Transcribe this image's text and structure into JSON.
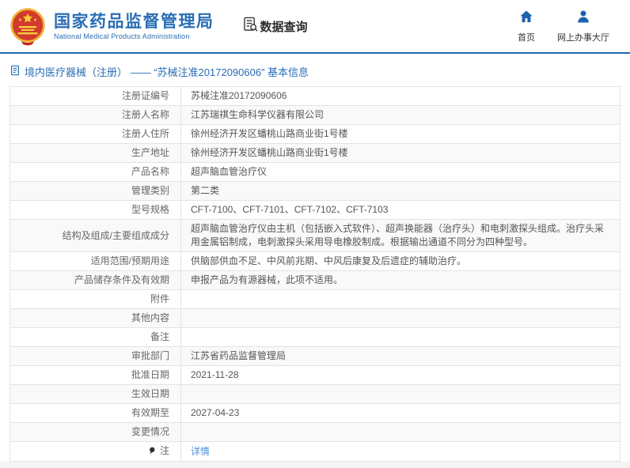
{
  "header": {
    "brand_title": "国家药品监督管理局",
    "brand_subtitle": "National Medical Products Administration",
    "data_query_label": "数据查询",
    "nav": [
      {
        "label": "首页",
        "icon": "home-icon"
      },
      {
        "label": "网上办事大厅",
        "icon": "user-icon"
      }
    ]
  },
  "breadcrumb": {
    "text": "境内医疗器械（注册） —— “苏械注准20172090606” 基本信息"
  },
  "table": {
    "rows": [
      {
        "label": "注册证编号",
        "value": "苏械注准20172090606"
      },
      {
        "label": "注册人名称",
        "value": "江苏瑞祺生命科学仪器有限公司"
      },
      {
        "label": "注册人住所",
        "value": "徐州经济开发区蟠桃山路商业街1号楼"
      },
      {
        "label": "生产地址",
        "value": "徐州经济开发区蟠桃山路商业街1号楼"
      },
      {
        "label": "产品名称",
        "value": "超声脑血管治疗仪"
      },
      {
        "label": "管理类别",
        "value": "第二类"
      },
      {
        "label": "型号规格",
        "value": "CFT-7100、CFT-7101、CFT-7102、CFT-7103"
      },
      {
        "label": "结构及组成/主要组成成分",
        "value": "超声脑血管治疗仪由主机（包括嵌入式软件）、超声换能器（治疗头）和电刺激探头组成。治疗头采用金属铝制成，电刺激探头采用导电橡胶制成。根据输出通道不同分为四种型号。"
      },
      {
        "label": "适用范围/预期用途",
        "value": "供脑部供血不足、中风前兆期、中风后康复及后遗症的辅助治疗。"
      },
      {
        "label": "产品储存条件及有效期",
        "value": "申报产品为有源器械，此项不适用。"
      },
      {
        "label": "附件",
        "value": ""
      },
      {
        "label": "其他内容",
        "value": ""
      },
      {
        "label": "备注",
        "value": ""
      },
      {
        "label": "审批部门",
        "value": "江苏省药品监督管理局"
      },
      {
        "label": "批准日期",
        "value": "2021-11-28"
      },
      {
        "label": "生效日期",
        "value": ""
      },
      {
        "label": "有效期至",
        "value": "2027-04-23"
      },
      {
        "label": "变更情况",
        "value": ""
      },
      {
        "label": "注",
        "value": "详情",
        "link": true,
        "icon": "pin-icon"
      }
    ]
  },
  "colors": {
    "brand_blue": "#2a6db5",
    "divider_blue": "#2467ad",
    "nav_icon_blue": "#1b62ad",
    "link_blue": "#4a90d9",
    "emblem_red": "#d23a2e",
    "emblem_gold": "#f0b429"
  }
}
